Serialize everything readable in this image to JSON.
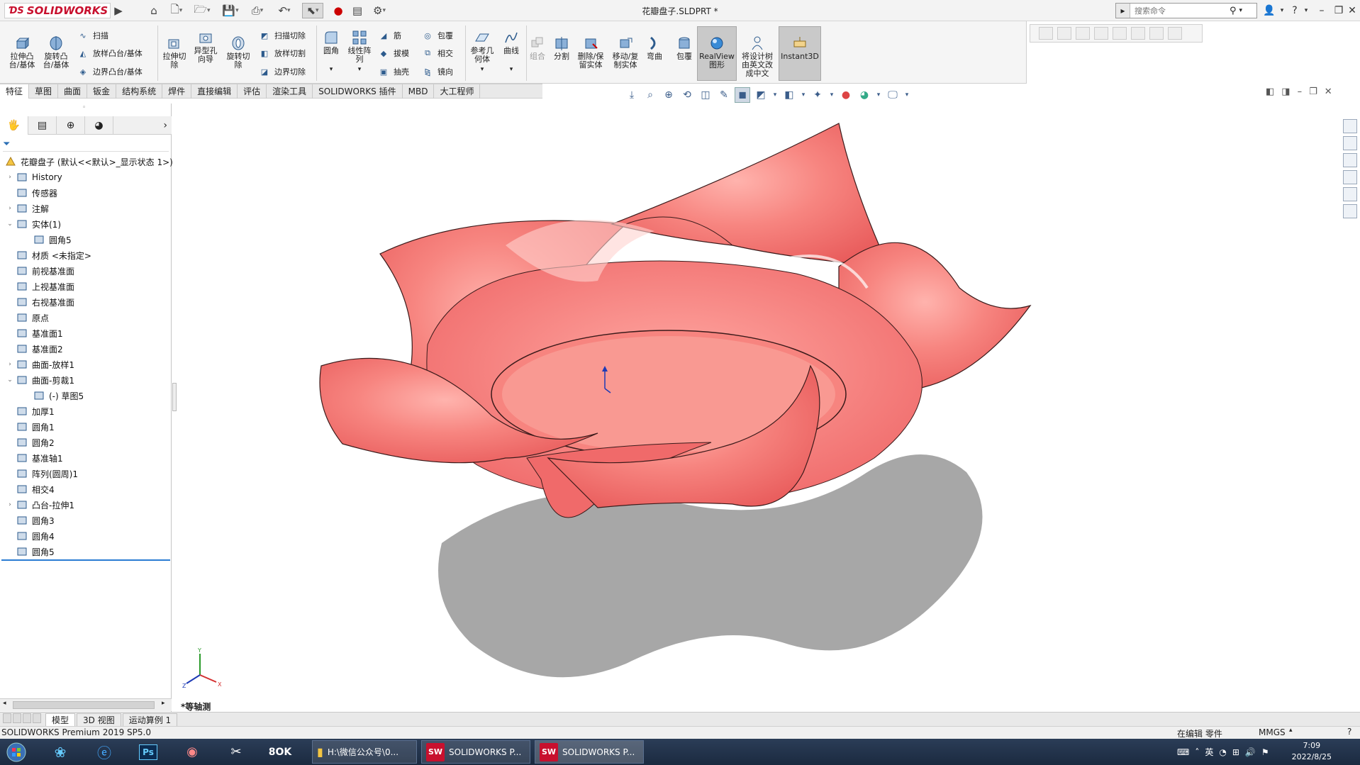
{
  "titlebar": {
    "logo": "SOLIDWORKS",
    "document_title": "花瓣盘子.SLDPRT *",
    "search_placeholder": "搜索命令",
    "help": "?"
  },
  "ribbon": {
    "big_left": [
      {
        "label": "拉伸凸\n台/基体"
      },
      {
        "label": "旋转凸\n台/基体"
      }
    ],
    "small_group1": [
      "扫描",
      "放样凸台/基体",
      "边界凸台/基体"
    ],
    "mid_big": [
      {
        "label": "拉伸切\n除"
      },
      {
        "label": "异型孔\n向导"
      },
      {
        "label": "旋转切\n除"
      }
    ],
    "small_group2": [
      "扫描切除",
      "放样切割",
      "边界切除"
    ],
    "fillet_big": [
      {
        "label": "圆角"
      },
      {
        "label": "线性阵\n列"
      }
    ],
    "small_group3": [
      "筋",
      "拔模",
      "抽壳"
    ],
    "small_group4": [
      "包覆",
      "相交",
      "镜向"
    ],
    "ref_big": [
      {
        "label": "参考几\n何体"
      },
      {
        "label": "曲线"
      }
    ],
    "right_big": [
      {
        "label": "组合"
      },
      {
        "label": "分割"
      },
      {
        "label": "删除/保\n留实体"
      },
      {
        "label": "移动/复\n制实体"
      },
      {
        "label": "弯曲"
      },
      {
        "label": "包覆"
      },
      {
        "label": "RealView\n图形"
      },
      {
        "label": "将设计树\n由英文改\n成中文"
      },
      {
        "label": "Instant3D"
      }
    ]
  },
  "tabs": [
    "特征",
    "草图",
    "曲面",
    "钣金",
    "结构系统",
    "焊件",
    "直接编辑",
    "评估",
    "渲染工具",
    "SOLIDWORKS 插件",
    "MBD",
    "大工程师"
  ],
  "feature_tree": {
    "root": "花瓣盘子 (默认<<默认>_显示状态 1>)",
    "items": [
      {
        "label": "History",
        "expand": "›"
      },
      {
        "label": "传感器",
        "expand": ""
      },
      {
        "label": "注解",
        "expand": "›"
      },
      {
        "label": "实体(1)",
        "expand": "⌄"
      },
      {
        "label": "圆角5",
        "expand": ""
      },
      {
        "label": "材质 <未指定>",
        "expand": ""
      },
      {
        "label": "前视基准面",
        "expand": ""
      },
      {
        "label": "上视基准面",
        "expand": ""
      },
      {
        "label": "右视基准面",
        "expand": ""
      },
      {
        "label": "原点",
        "expand": ""
      },
      {
        "label": "基准面1",
        "expand": ""
      },
      {
        "label": "基准面2",
        "expand": ""
      },
      {
        "label": "曲面-放样1",
        "expand": "›"
      },
      {
        "label": "曲面-剪裁1",
        "expand": "⌄"
      },
      {
        "label": "(-) 草图5",
        "expand": ""
      },
      {
        "label": "加厚1",
        "expand": ""
      },
      {
        "label": "圆角1",
        "expand": ""
      },
      {
        "label": "圆角2",
        "expand": ""
      },
      {
        "label": "基准轴1",
        "expand": ""
      },
      {
        "label": "阵列(圆周)1",
        "expand": ""
      },
      {
        "label": "相交4",
        "expand": ""
      },
      {
        "label": "凸台-拉伸1",
        "expand": "›"
      },
      {
        "label": "圆角3",
        "expand": ""
      },
      {
        "label": "圆角4",
        "expand": ""
      },
      {
        "label": "圆角5",
        "expand": ""
      }
    ]
  },
  "bottom_tabs": [
    "模型",
    "3D 视图",
    "运动算例 1"
  ],
  "view_label": "*等轴测",
  "status": {
    "left": "SOLIDWORKS Premium 2019 SP5.0",
    "mode": "在编辑 零件",
    "units": "MMGS"
  },
  "taskbar": {
    "folder": "H:\\微信公众号\\0...",
    "sw1": "SOLIDWORKS P...",
    "sw2": "SOLIDWORKS P...",
    "time": "7:09",
    "date": "2022/8/25"
  },
  "colors": {
    "petal": "#f26b6b",
    "accent": "#c8102e",
    "selection": "#2b7cd3"
  }
}
